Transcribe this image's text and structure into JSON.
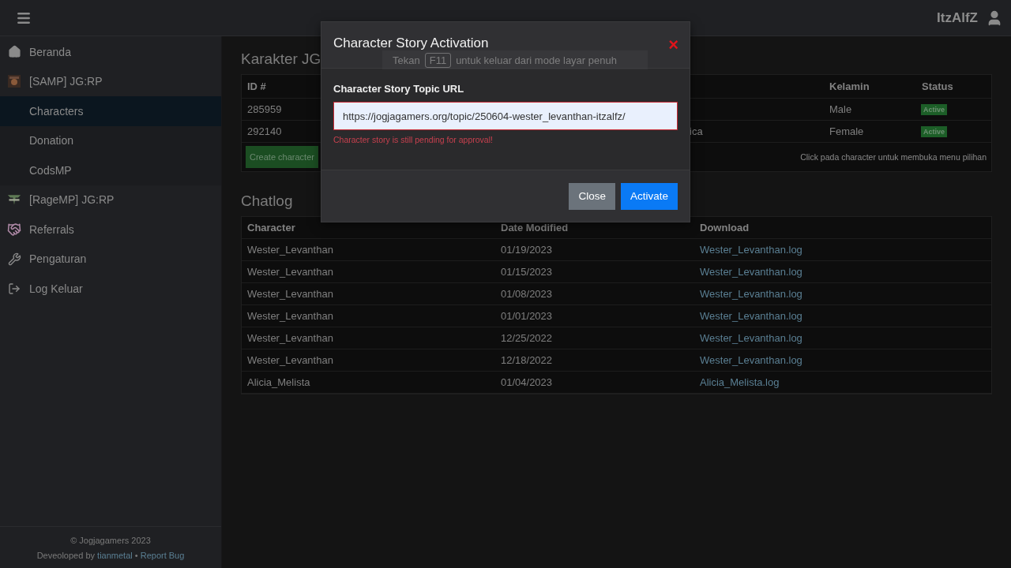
{
  "topbar": {
    "username": "ItzAlfZ"
  },
  "sidebar": {
    "items": [
      {
        "label": "Beranda",
        "selected": false
      },
      {
        "label": "[SAMP] JG:RP",
        "selected": false,
        "children": [
          {
            "label": "Characters",
            "selected": true
          },
          {
            "label": "Donation",
            "selected": false
          },
          {
            "label": "CodsMP",
            "selected": false
          }
        ]
      },
      {
        "label": "[RageMP] JG:RP",
        "selected": false
      },
      {
        "label": "Referrals",
        "selected": false
      },
      {
        "label": "Pengaturan",
        "selected": false
      },
      {
        "label": "Log Keluar",
        "selected": false
      }
    ],
    "footer": {
      "copyright": "© Jogjagamers 2023",
      "developed_prefix": "Deveoloped by",
      "developer": "tianmetal",
      "separator": "•",
      "report": "Report Bug"
    }
  },
  "characters": {
    "title": "Karakter JG",
    "columns": [
      "ID #",
      "",
      "Kelamin",
      "Status"
    ],
    "rows": [
      {
        "id": "285959",
        "column_2": "",
        "gender": "Male",
        "status": "Active"
      },
      {
        "id": "292140",
        "column_2": "ica",
        "gender": "Female",
        "status": "Active"
      }
    ],
    "create_button": "Create character",
    "hint": "Click pada character untuk membuka menu pilihan"
  },
  "chatlog": {
    "title": "Chatlog",
    "columns": [
      "Character",
      "Date Modified",
      "Download"
    ],
    "rows": [
      {
        "character": "Wester_Levanthan",
        "date": "01/19/2023",
        "file": "Wester_Levanthan.log"
      },
      {
        "character": "Wester_Levanthan",
        "date": "01/15/2023",
        "file": "Wester_Levanthan.log"
      },
      {
        "character": "Wester_Levanthan",
        "date": "01/08/2023",
        "file": "Wester_Levanthan.log"
      },
      {
        "character": "Wester_Levanthan",
        "date": "01/01/2023",
        "file": "Wester_Levanthan.log"
      },
      {
        "character": "Wester_Levanthan",
        "date": "12/25/2022",
        "file": "Wester_Levanthan.log"
      },
      {
        "character": "Wester_Levanthan",
        "date": "12/18/2022",
        "file": "Wester_Levanthan.log"
      },
      {
        "character": "Alicia_Melista",
        "date": "01/04/2023",
        "file": "Alicia_Melista.log"
      }
    ]
  },
  "modal": {
    "title": "Character Story Activation",
    "close": "×",
    "field_label": "Character Story Topic URL",
    "value": "https://jogjagamers.org/topic/250604-wester_levanthan-itzalfz/",
    "error": "Character story is still pending for approval!",
    "buttons": [
      {
        "label": "Close",
        "kind": "secondary"
      },
      {
        "label": "Activate",
        "kind": "primary"
      }
    ]
  },
  "fullscreen_notice": {
    "before": "Tekan",
    "key": "F11",
    "after": "untuk keluar dari mode layar penuh"
  }
}
